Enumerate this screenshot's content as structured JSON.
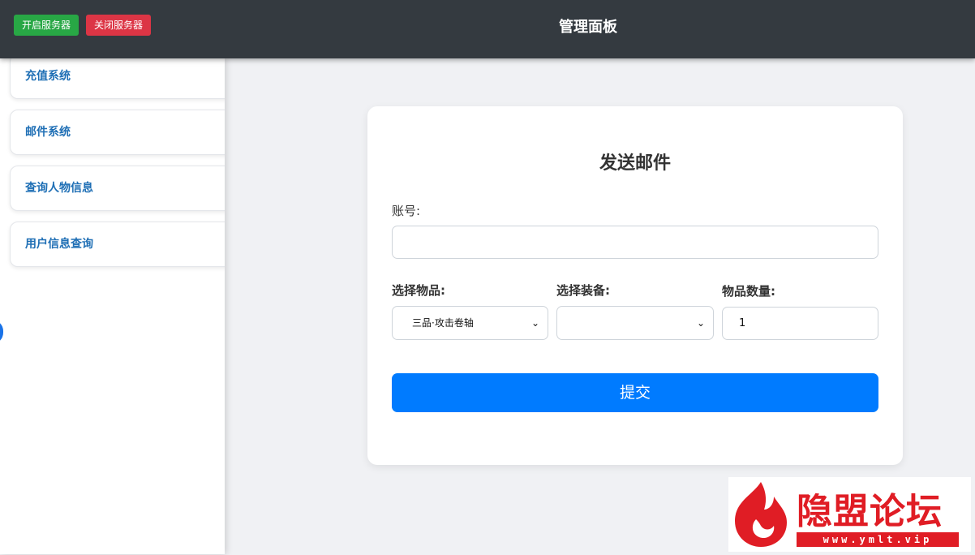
{
  "header": {
    "start_label": "开启服务器",
    "stop_label": "关闭服务器",
    "title": "管理面板"
  },
  "sidebar": {
    "items": [
      {
        "label": "充值系统"
      },
      {
        "label": "邮件系统"
      },
      {
        "label": "查询人物信息"
      },
      {
        "label": "用户信息查询"
      }
    ]
  },
  "form": {
    "title": "发送邮件",
    "account_label": "账号:",
    "account_value": "",
    "item_label": "选择物品:",
    "item_selected": "三品·攻击卷轴",
    "equip_label": "选择装备:",
    "equip_selected": "",
    "qty_label": "物品数量:",
    "qty_value": "1",
    "submit_label": "提交"
  },
  "watermark": {
    "text": "隐盟论坛",
    "url": "www.ymlt.vip"
  },
  "colors": {
    "topbar": "#343a40",
    "start": "#28a745",
    "stop": "#dc3545",
    "primary": "#007bff",
    "sidebar_text": "#1f6fb5",
    "watermark": "#e01d25"
  }
}
